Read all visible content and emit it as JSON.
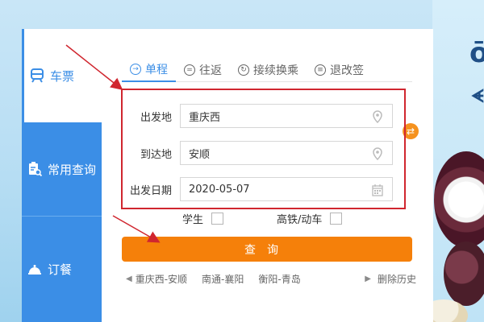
{
  "sidebar": {
    "items": [
      {
        "label": "车票",
        "icon": "train-icon",
        "active": true
      },
      {
        "label": "常用查询",
        "icon": "clipboard-search-icon",
        "active": false
      },
      {
        "label": "订餐",
        "icon": "food-cover-icon",
        "active": false
      }
    ]
  },
  "tabs": [
    {
      "label": "单程",
      "icon": "arrow-circle-icon",
      "active": true
    },
    {
      "label": "往返",
      "icon": "swap-circle-icon",
      "active": false
    },
    {
      "label": "接续换乘",
      "icon": "transfer-circle-icon",
      "active": false
    },
    {
      "label": "退改签",
      "icon": "ticket-circle-icon",
      "active": false
    }
  ],
  "form": {
    "from_label": "出发地",
    "from_value": "重庆西",
    "to_label": "到达地",
    "to_value": "安顺",
    "date_label": "出发日期",
    "date_value": "2020-05-07"
  },
  "options": {
    "student_label": "学生",
    "highspeed_label": "高铁/动车"
  },
  "search_label": "查询",
  "history": {
    "items": [
      "重庆西-安顺",
      "南通-襄阳",
      "衡阳-青岛"
    ],
    "clear_label": "删除历史"
  },
  "colors": {
    "primary": "#3b8ee6",
    "accent": "#f5800a",
    "annotation": "#d0262f"
  }
}
